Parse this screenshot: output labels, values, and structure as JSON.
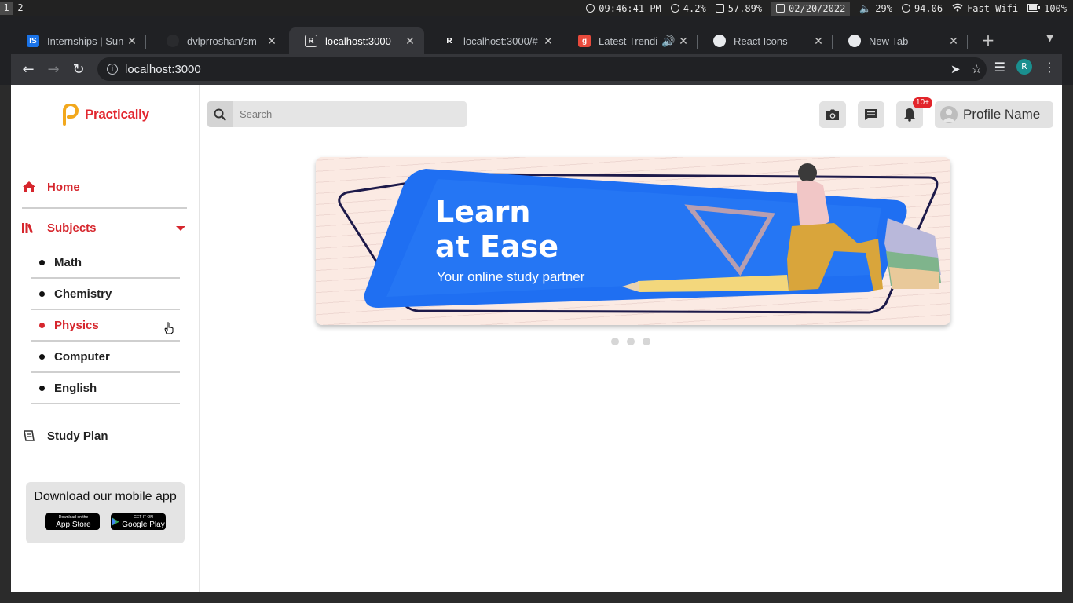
{
  "system_bar": {
    "workspaces": [
      "1",
      "2"
    ],
    "time": "09:46:41 PM",
    "cpu": "4.2%",
    "memory": "57.89%",
    "date": "02/20/2022",
    "volume": "29%",
    "temp": "94.06",
    "wifi": "Fast Wifi",
    "battery": "100%"
  },
  "browser": {
    "tabs": [
      {
        "title": "Internships | Sun",
        "favicon": "IS",
        "color": "#1a73e8"
      },
      {
        "title": "dvlprroshan/sm",
        "favicon": "github-icon",
        "color": "#202124"
      },
      {
        "title": "localhost:3000",
        "favicon": "R",
        "color": "#35363a"
      },
      {
        "title": "localhost:3000/#",
        "favicon": "R",
        "color": "#202124"
      },
      {
        "title": "Latest Trendi",
        "favicon": "g",
        "color": "#e84a3c"
      },
      {
        "title": "React Icons",
        "favicon": "globe-icon",
        "color": "#202124"
      },
      {
        "title": "New Tab",
        "favicon": "chrome-icon",
        "color": "#202124"
      }
    ],
    "url": "localhost:3000",
    "profile_initial": "R"
  },
  "sidebar": {
    "logo_text": "Practically",
    "home": "Home",
    "subjects": "Subjects",
    "subject_items": [
      "Math",
      "Chemistry",
      "Physics",
      "Computer",
      "English"
    ],
    "active_subject": "Physics",
    "study_plan": "Study Plan",
    "app_card": {
      "text": "Download our mobile app",
      "appstore_small": "Download on the",
      "appstore": "App Store",
      "googleplay_small": "GET IT ON",
      "googleplay": "Google Play"
    }
  },
  "header": {
    "search_placeholder": "Search",
    "notification_count": "10+",
    "profile_name": "Profile Name"
  },
  "banner": {
    "line1": "Learn",
    "line2": "at Ease",
    "subtitle": "Your online study partner",
    "slide_count": 3,
    "active_slide": 0
  },
  "colors": {
    "brand_red": "#d6262d",
    "banner_blue": "#1f6ff2",
    "chrome_dark": "#202124"
  }
}
